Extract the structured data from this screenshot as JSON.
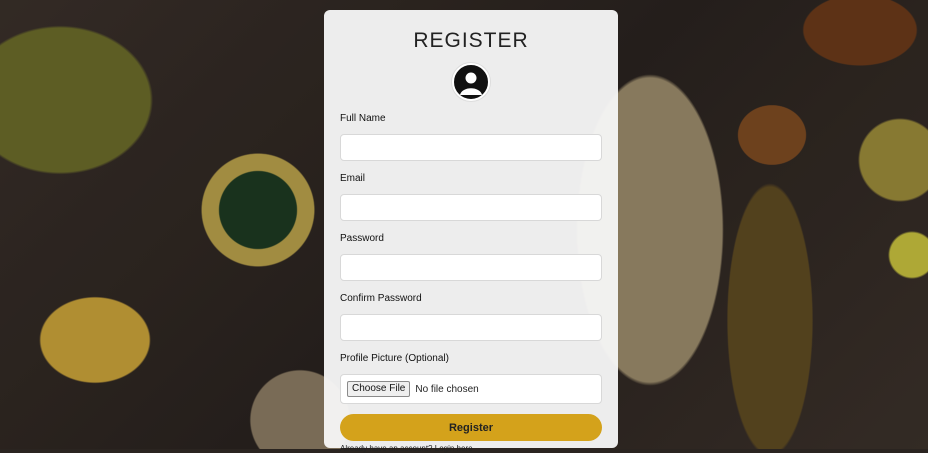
{
  "form": {
    "title": "REGISTER",
    "fields": [
      {
        "label": "Full Name",
        "value": "",
        "placeholder": ""
      },
      {
        "label": "Email",
        "value": "",
        "placeholder": ""
      },
      {
        "label": "Password",
        "value": "",
        "placeholder": ""
      },
      {
        "label": "Confirm Password",
        "value": "",
        "placeholder": ""
      }
    ],
    "file": {
      "label": "Profile Picture (Optional)",
      "button_label": "Choose File",
      "status": "No file chosen"
    },
    "submit_label": "Register",
    "login_prompt": "Already have an account?",
    "login_link": "Login here"
  },
  "colors": {
    "accent": "#d4a21b",
    "card_background": "#f6f6f6"
  },
  "icons": {
    "avatar": "user-circle-icon"
  }
}
